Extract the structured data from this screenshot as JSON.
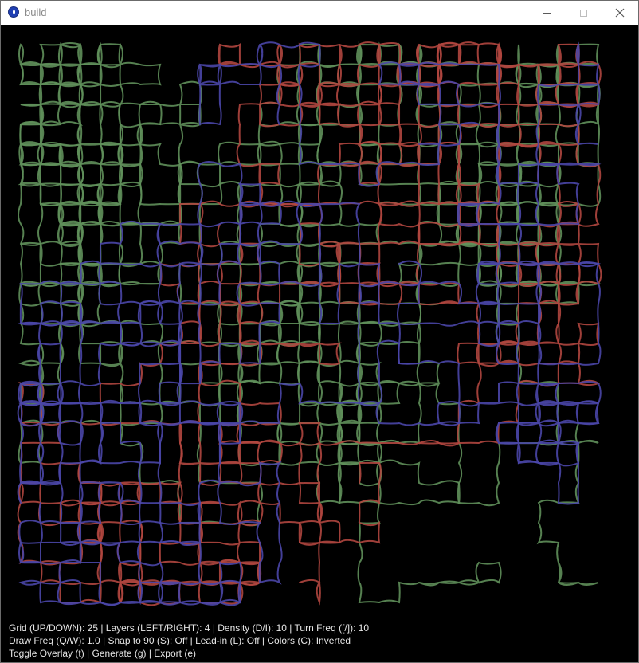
{
  "window": {
    "title": "build"
  },
  "icons": {
    "app": "app-icon",
    "minimize": "minimize-icon",
    "maximize": "maximize-icon",
    "close": "close-icon"
  },
  "colors": {
    "background": "#000000",
    "green": "#5f8f5a",
    "red": "#b0463f",
    "blue": "#4a46a8",
    "overlay_text": "#e6e6e6"
  },
  "overlay": {
    "line1": "Grid (UP/DOWN): 25 | Layers (LEFT/RIGHT): 4 | Density (D/I): 10 | Turn Freq ([/]): 10",
    "line2": "Draw Freq (Q/W): 1.0 | Snap to 90 (S): Off | Lead-in (L): Off | Colors (C): Inverted",
    "line3": "Toggle Overlay (t) | Generate (g) | Export (e)"
  }
}
